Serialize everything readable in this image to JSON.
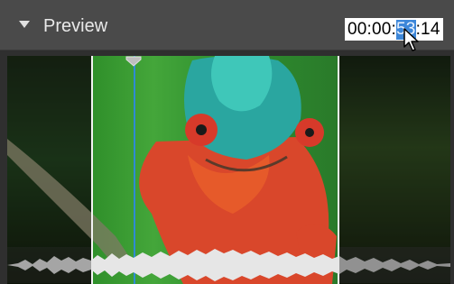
{
  "panel": {
    "title": "Preview",
    "timecode": {
      "prefix": "00:00:",
      "selected": "53",
      "suffix": ":14"
    }
  },
  "colors": {
    "header_bg": "#4a4a4a",
    "selection": "#3d87d9",
    "playhead": "#2f8bd4"
  },
  "icons": {
    "collapse": "triangle-down-icon",
    "cursor": "arrow-cursor-icon"
  }
}
